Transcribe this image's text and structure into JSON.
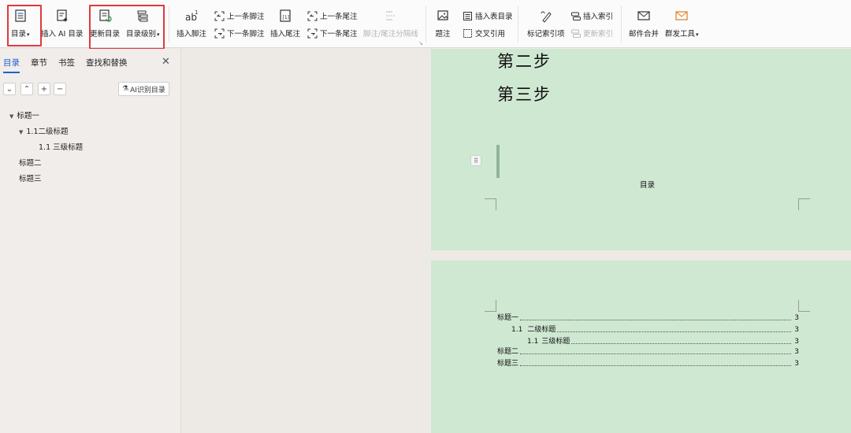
{
  "ribbon": {
    "toc_button": "目录",
    "insert_ai_toc": "插入 AI 目录",
    "update_toc": "更新目录",
    "toc_level": "目录级别",
    "insert_footnote": "插入脚注",
    "prev_footnote": "上一条脚注",
    "next_footnote": "下一条脚注",
    "insert_endnote": "插入尾注",
    "prev_endnote": "上一条尾注",
    "next_endnote": "下一条尾注",
    "footnote_separator": "脚注/尾注分隔线",
    "caption": "题注",
    "insert_table_of_figures": "插入表目录",
    "cross_reference": "交叉引用",
    "mark_index_entry": "标记索引项",
    "insert_index": "插入索引",
    "update_index": "更新索引",
    "mail_merge": "邮件合并",
    "mass_mail_tool": "群发工具"
  },
  "nav_pane": {
    "tabs": [
      "目录",
      "章节",
      "书签",
      "查找和替换"
    ],
    "ai_button": "AI识别目录",
    "tree": [
      {
        "label": "标题一",
        "level": 1,
        "expanded": true
      },
      {
        "label": "1.1二级标题",
        "level": 2,
        "expanded": true
      },
      {
        "label": "1.1 三级标题",
        "level": 3
      },
      {
        "label": "标题二",
        "level": 1
      },
      {
        "label": "标题三",
        "level": 1
      }
    ]
  },
  "document": {
    "heading_step2": "第二步",
    "heading_step3": "第三步",
    "toc_title": "目录",
    "toc_entries": [
      {
        "num": "",
        "text": "标题一",
        "page": "3"
      },
      {
        "num": "1.1",
        "text": "二级标题",
        "page": "3"
      },
      {
        "num": "1.1",
        "text": "三级标题",
        "page": "3"
      },
      {
        "num": "",
        "text": "标题二",
        "page": "3"
      },
      {
        "num": "",
        "text": "标题三",
        "page": "3"
      }
    ]
  },
  "colors": {
    "page_bg": "#cfe8d2",
    "highlight_box": "#e0393e",
    "active_tab": "#1d5fd0",
    "workspace_bg": "#edeae6"
  }
}
